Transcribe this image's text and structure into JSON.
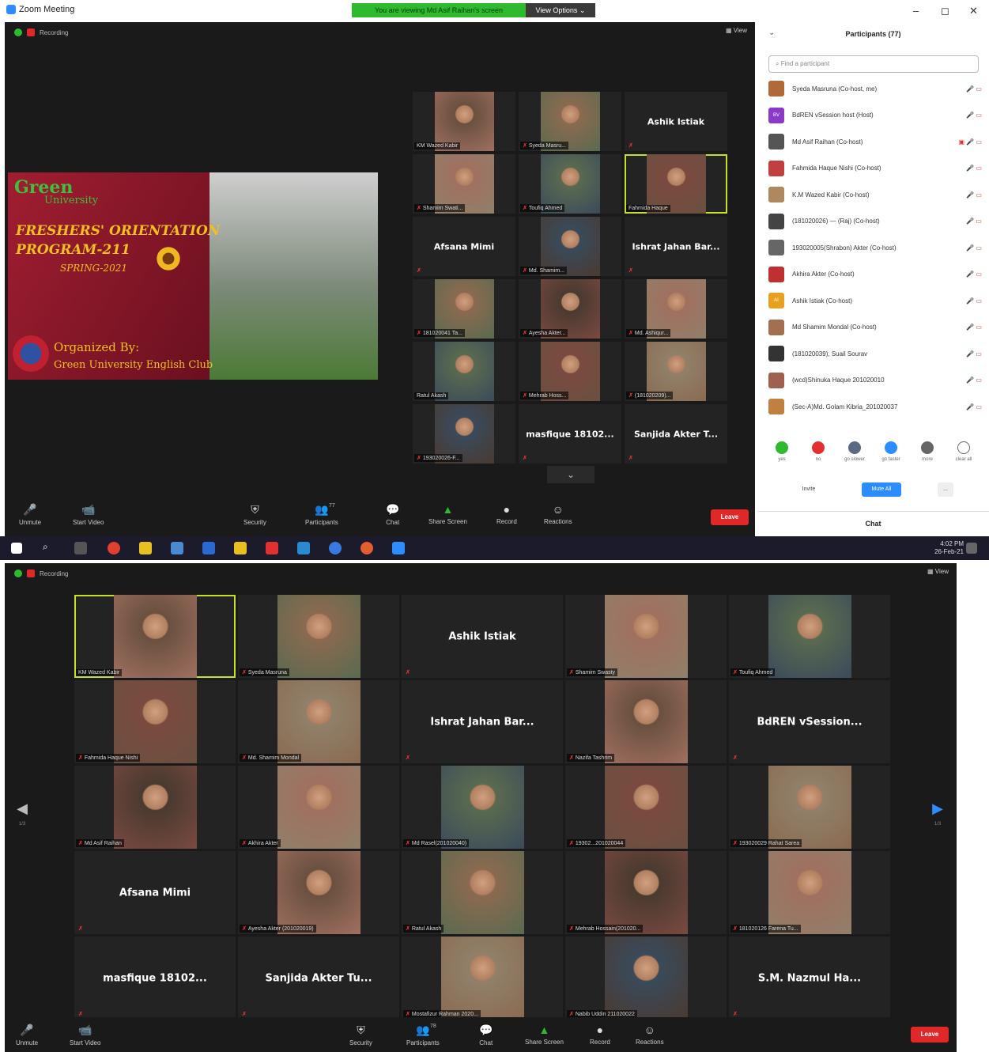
{
  "window": {
    "title": "Zoom Meeting",
    "share_banner": "You are viewing Md Asif Raihan's screen",
    "view_options": "View Options ⌄",
    "controls": [
      "–",
      "◻",
      "✕"
    ]
  },
  "meeting_top": {
    "recording_label": "Recording",
    "view_label": "▦ View",
    "shared_slide": {
      "brand": "Green",
      "brand_sub": "University",
      "line1": "FRESHERS' ORIENTATION",
      "line2": "PROGRAM-211",
      "line3": "SPRING-2021",
      "org1": "Organized By:",
      "org2": "Green University English Club"
    },
    "tiles": [
      {
        "type": "photo",
        "name": "KM Wazed Kabir",
        "mic": false
      },
      {
        "type": "photo",
        "name": "Syeda Masru...",
        "mic": true
      },
      {
        "type": "text",
        "big": "Ashik Istiak",
        "mic": true
      },
      {
        "type": "photo",
        "name": "Shamim Swati...",
        "mic": true
      },
      {
        "type": "photo",
        "name": "Toufiq Ahmed",
        "mic": true
      },
      {
        "type": "photo",
        "name": "Fahmida Haque",
        "mic": false,
        "active": true
      },
      {
        "type": "text",
        "big": "Afsana Mimi",
        "mic": true
      },
      {
        "type": "photo",
        "name": "Md. Shamim...",
        "mic": true
      },
      {
        "type": "text",
        "big": "Ishrat Jahan Bar...",
        "mic": true
      },
      {
        "type": "photo",
        "name": "181020041 Ta...",
        "mic": true
      },
      {
        "type": "photo",
        "name": "Ayesha Akter...",
        "mic": true
      },
      {
        "type": "photo",
        "name": "Md. Ashiqur...",
        "mic": true
      },
      {
        "type": "photo",
        "name": "Ratul Akash",
        "mic": false
      },
      {
        "type": "photo",
        "name": "Mehrab Hoss...",
        "mic": true
      },
      {
        "type": "photo",
        "name": "(181020209)...",
        "mic": true
      },
      {
        "type": "photo",
        "name": "193020026-F...",
        "mic": true
      },
      {
        "type": "text",
        "big": "masfique 18102...",
        "mic": true
      },
      {
        "type": "text",
        "big": "Sanjida Akter T...",
        "mic": true
      }
    ],
    "more_arrow": "⌄"
  },
  "toolbar_top": {
    "items": [
      {
        "icon": "🎤",
        "label": "Unmute"
      },
      {
        "icon": "📹",
        "label": "Start Video"
      },
      {
        "icon": "⛨",
        "label": "Security"
      },
      {
        "icon": "👥",
        "label": "Participants",
        "badge": "77"
      },
      {
        "icon": "💬",
        "label": "Chat"
      },
      {
        "icon": "▲",
        "label": "Share Screen"
      },
      {
        "icon": "●",
        "label": "Record"
      },
      {
        "icon": "☺",
        "label": "Reactions"
      }
    ],
    "leave": "Leave"
  },
  "participants_panel": {
    "title": "Participants (77)",
    "search_placeholder": "Find a participant",
    "rows": [
      {
        "name": "Syeda Masruna (Co-host, me)",
        "color": "#b06a3a",
        "icons": "🎤 ▭"
      },
      {
        "name": "BdREN vSession host (Host)",
        "color": "#8b3ac8",
        "initials": "BV",
        "icons": "🎤 ▭"
      },
      {
        "name": "Md Asif Raihan (Co-host)",
        "color": "#555555",
        "icons": "▣ 🎤 ▭"
      },
      {
        "name": "Fahmida Haque Nishi (Co-host)",
        "color": "#c04040",
        "icons": "🎤 ▭"
      },
      {
        "name": "K.M Wazed Kabir (Co-host)",
        "color": "#b08860",
        "icons": "🎤 ▭"
      },
      {
        "name": "(181020026) — (Raj) (Co-host)",
        "color": "#444444",
        "icons": "🎤 ▭"
      },
      {
        "name": "193020005(Shrabon) Akter (Co-host)",
        "color": "#666666",
        "icons": "🎤 ▭"
      },
      {
        "name": "Akhira Akter (Co-host)",
        "color": "#c03030",
        "icons": "🎤 ▭"
      },
      {
        "name": "Ashik Istiak (Co-host)",
        "color": "#e8a020",
        "initials": "AI",
        "icons": "🎤 ▭"
      },
      {
        "name": "Md Shamim Mondal (Co-host)",
        "color": "#a07050",
        "icons": "🎤 ▭"
      },
      {
        "name": "(181020039), Suail Sourav",
        "color": "#333333",
        "icons": "🎤 ▭"
      },
      {
        "name": "(wcd)Shinuka Haque 201020010",
        "color": "#a06050",
        "icons": "🎤 ▭"
      },
      {
        "name": "(Sec-A)Md. Golam Kibria_201020037",
        "color": "#c08040",
        "icons": "🎤 ▭"
      }
    ],
    "reactions": [
      {
        "label": "yes",
        "color": "#2dbb2d"
      },
      {
        "label": "no",
        "color": "#e03030"
      },
      {
        "label": "go slower",
        "color": "#5a6a80"
      },
      {
        "label": "go faster",
        "color": "#2d8cff"
      },
      {
        "label": "more",
        "color": "#666666"
      },
      {
        "label": "clear all",
        "color": "#ffffff"
      }
    ],
    "invite": "Invite",
    "mute_all": "Mute All",
    "more": "...",
    "chat": "Chat"
  },
  "taskbar": {
    "time": "4:02 PM",
    "date": "26-Feb-21"
  },
  "meeting_bottom": {
    "recording_label": "Recording",
    "view_label": "▦ View",
    "page_left": "1/3",
    "page_right": "1/3",
    "tiles": [
      {
        "type": "photo",
        "name": "KM Wazed Kabir",
        "mic": false,
        "active": true
      },
      {
        "type": "photo",
        "name": "Syeda Masruna",
        "mic": true
      },
      {
        "type": "text",
        "big": "Ashik Istiak",
        "mic": true
      },
      {
        "type": "photo",
        "name": "Shamim Swasty",
        "mic": true
      },
      {
        "type": "photo",
        "name": "Toufiq Ahmed",
        "mic": true
      },
      {
        "type": "photo",
        "name": "Fahmida Haque Nishi",
        "mic": true
      },
      {
        "type": "photo",
        "name": "Md. Shamim Mondal",
        "mic": true
      },
      {
        "type": "text",
        "big": "Ishrat Jahan Bar...",
        "mic": true
      },
      {
        "type": "photo",
        "name": "Nazifa Tashrim",
        "mic": true
      },
      {
        "type": "text",
        "big": "BdREN vSession...",
        "mic": true
      },
      {
        "type": "photo",
        "name": "Md Asif Raihan",
        "mic": true
      },
      {
        "type": "photo",
        "name": "Akhira Akter",
        "mic": true
      },
      {
        "type": "photo",
        "name": "Md Rasel(201020040)",
        "mic": true
      },
      {
        "type": "photo",
        "name": "19302...201020044",
        "mic": true
      },
      {
        "type": "photo",
        "name": "193020029 Rahat Sarea",
        "mic": true
      },
      {
        "type": "text",
        "big": "Afsana Mimi",
        "mic": true
      },
      {
        "type": "photo",
        "name": "Ayesha Akter (201020019)",
        "mic": true
      },
      {
        "type": "photo",
        "name": "Ratul Akash",
        "mic": true
      },
      {
        "type": "photo",
        "name": "Mehrab Hossain(201020...",
        "mic": true
      },
      {
        "type": "photo",
        "name": "181020126 Farena Tu...",
        "mic": true
      },
      {
        "type": "text",
        "big": "masfique 18102...",
        "mic": true
      },
      {
        "type": "text",
        "big": "Sanjida Akter Tu...",
        "mic": true
      },
      {
        "type": "photo",
        "name": "Mostafizur Rahman 2020...",
        "mic": true
      },
      {
        "type": "photo",
        "name": "Nabib Uddin 211020022",
        "mic": true
      },
      {
        "type": "text",
        "big": "S.M. Nazmul Ha...",
        "mic": true
      }
    ]
  },
  "toolbar_bottom": {
    "items": [
      {
        "icon": "🎤",
        "label": "Unmute"
      },
      {
        "icon": "📹",
        "label": "Start Video"
      },
      {
        "icon": "⛨",
        "label": "Security"
      },
      {
        "icon": "👥",
        "label": "Participants",
        "badge": "78"
      },
      {
        "icon": "💬",
        "label": "Chat"
      },
      {
        "icon": "▲",
        "label": "Share Screen"
      },
      {
        "icon": "●",
        "label": "Record"
      },
      {
        "icon": "☺",
        "label": "Reactions"
      }
    ],
    "leave": "Leave"
  }
}
